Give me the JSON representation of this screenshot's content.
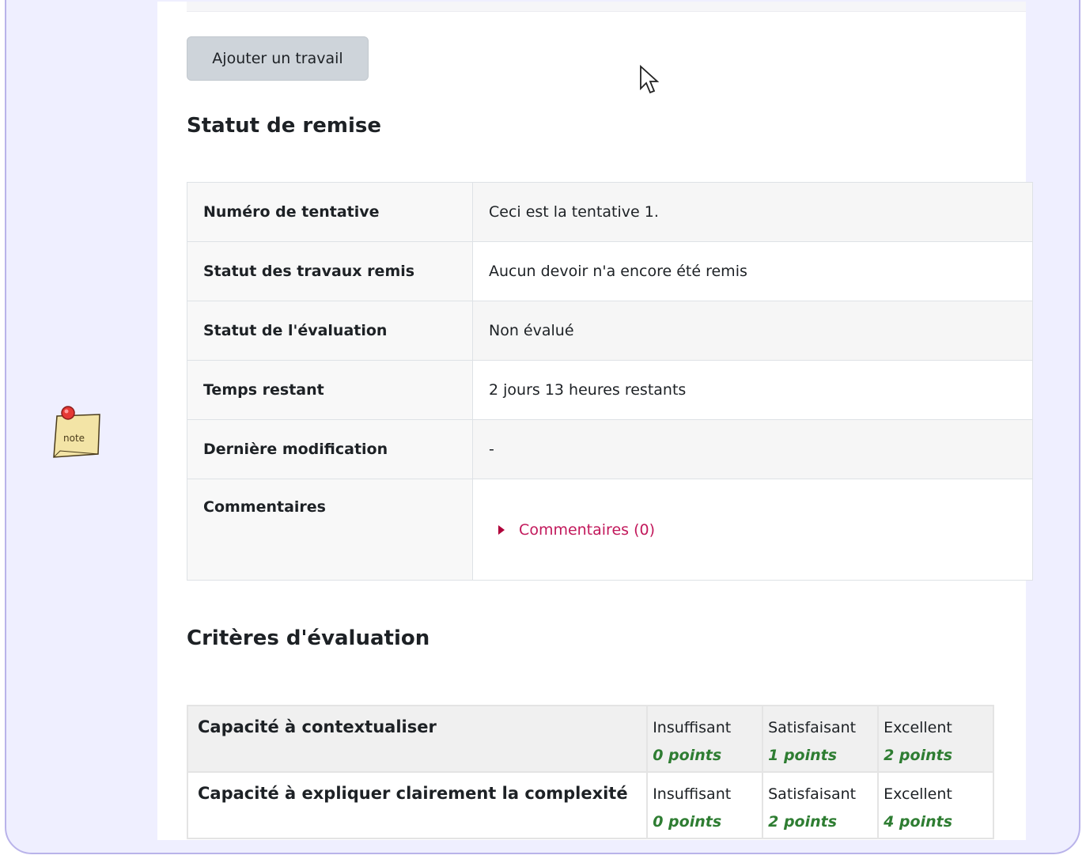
{
  "buttons": {
    "add_work": "Ajouter un travail"
  },
  "headings": {
    "status": "Statut de remise",
    "criteria": "Critères d'évaluation"
  },
  "status_rows": [
    {
      "label": "Numéro de tentative",
      "value": "Ceci est la tentative 1."
    },
    {
      "label": "Statut des travaux remis",
      "value": "Aucun devoir n'a encore été remis"
    },
    {
      "label": "Statut de l'évaluation",
      "value": "Non évalué"
    },
    {
      "label": "Temps restant",
      "value": "2 jours 13 heures restants"
    },
    {
      "label": "Dernière modification",
      "value": "-"
    },
    {
      "label": "Commentaires",
      "value": "Commentaires (0)"
    }
  ],
  "rubric": [
    {
      "criterion": "Capacité à contextualiser",
      "levels": [
        {
          "name": "Insuffisant",
          "points": "0 points"
        },
        {
          "name": "Satisfaisant",
          "points": "1 points"
        },
        {
          "name": "Excellent",
          "points": "2 points"
        }
      ]
    },
    {
      "criterion": "Capacité à expliquer clairement la complexité",
      "levels": [
        {
          "name": "Insuffisant",
          "points": "0 points"
        },
        {
          "name": "Satisfaisant",
          "points": "2 points"
        },
        {
          "name": "Excellent",
          "points": "4 points"
        }
      ]
    }
  ],
  "note_icon": {
    "text": "note"
  },
  "colors": {
    "link": "#c2185b",
    "points": "#2e7d32",
    "frame_border": "#b9b3ea"
  }
}
